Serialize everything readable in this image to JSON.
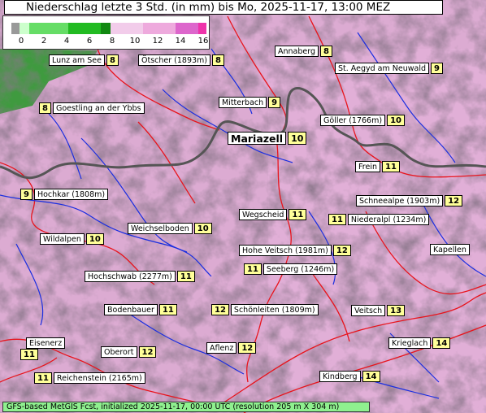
{
  "title": "Niederschlag letzte 3 Std. (in mm) bis Mo, 2025-11-17, 13:00 MEZ",
  "legend": {
    "ticks": [
      "0",
      "2",
      "4",
      "6",
      "8",
      "10",
      "12",
      "14",
      "16"
    ],
    "colors": [
      "#999999",
      "#ccffcc",
      "#66dd66",
      "#22bb22",
      "#118811",
      "#f2ccea",
      "#eeaadd",
      "#dd66cc",
      "#ee33aa"
    ]
  },
  "stations": [
    {
      "name": "Lunz am See",
      "value": "8"
    },
    {
      "name": "Ötscher (1893m)",
      "value": "8"
    },
    {
      "name": "Annaberg",
      "value": "8"
    },
    {
      "name": "St. Aegyd am Neuwald",
      "value": "9"
    },
    {
      "name": "Goestling an der Ybbs",
      "value": "8"
    },
    {
      "name": "Mitterbach",
      "value": "9"
    },
    {
      "name": "Göller (1766m)",
      "value": "10"
    },
    {
      "name": "Mariazell",
      "value": "10"
    },
    {
      "name": "Frein",
      "value": "11"
    },
    {
      "name": "Hochkar (1808m)",
      "value": "9"
    },
    {
      "name": "Schneealpe (1903m)",
      "value": "12"
    },
    {
      "name": "Wegscheid",
      "value": "11"
    },
    {
      "name": "Niederalpl (1234m)",
      "value": "11"
    },
    {
      "name": "Weichselboden",
      "value": "10"
    },
    {
      "name": "Wildalpen",
      "value": "10"
    },
    {
      "name": "Hohe Veitsch (1981m)",
      "value": "12"
    },
    {
      "name": "Kapellen",
      "value": ""
    },
    {
      "name": "Seeberg (1246m)",
      "value": "11"
    },
    {
      "name": "Hochschwab (2277m)",
      "value": "11"
    },
    {
      "name": "Bodenbauer",
      "value": "11"
    },
    {
      "name": "Schönleiten (1809m)",
      "value": "12"
    },
    {
      "name": "Veitsch",
      "value": "13"
    },
    {
      "name": "Eisenerz",
      "value": "11"
    },
    {
      "name": "Oberort",
      "value": "12"
    },
    {
      "name": "Aflenz",
      "value": "12"
    },
    {
      "name": "Krieglach",
      "value": "14"
    },
    {
      "name": "Reichenstein (2165m)",
      "value": "11"
    },
    {
      "name": "Kindberg",
      "value": "14"
    }
  ],
  "footer": "GFS-based MetGIS Fcst, initialized 2025-11-17, 00:00 UTC  (resolution 205 m X 304 m)"
}
